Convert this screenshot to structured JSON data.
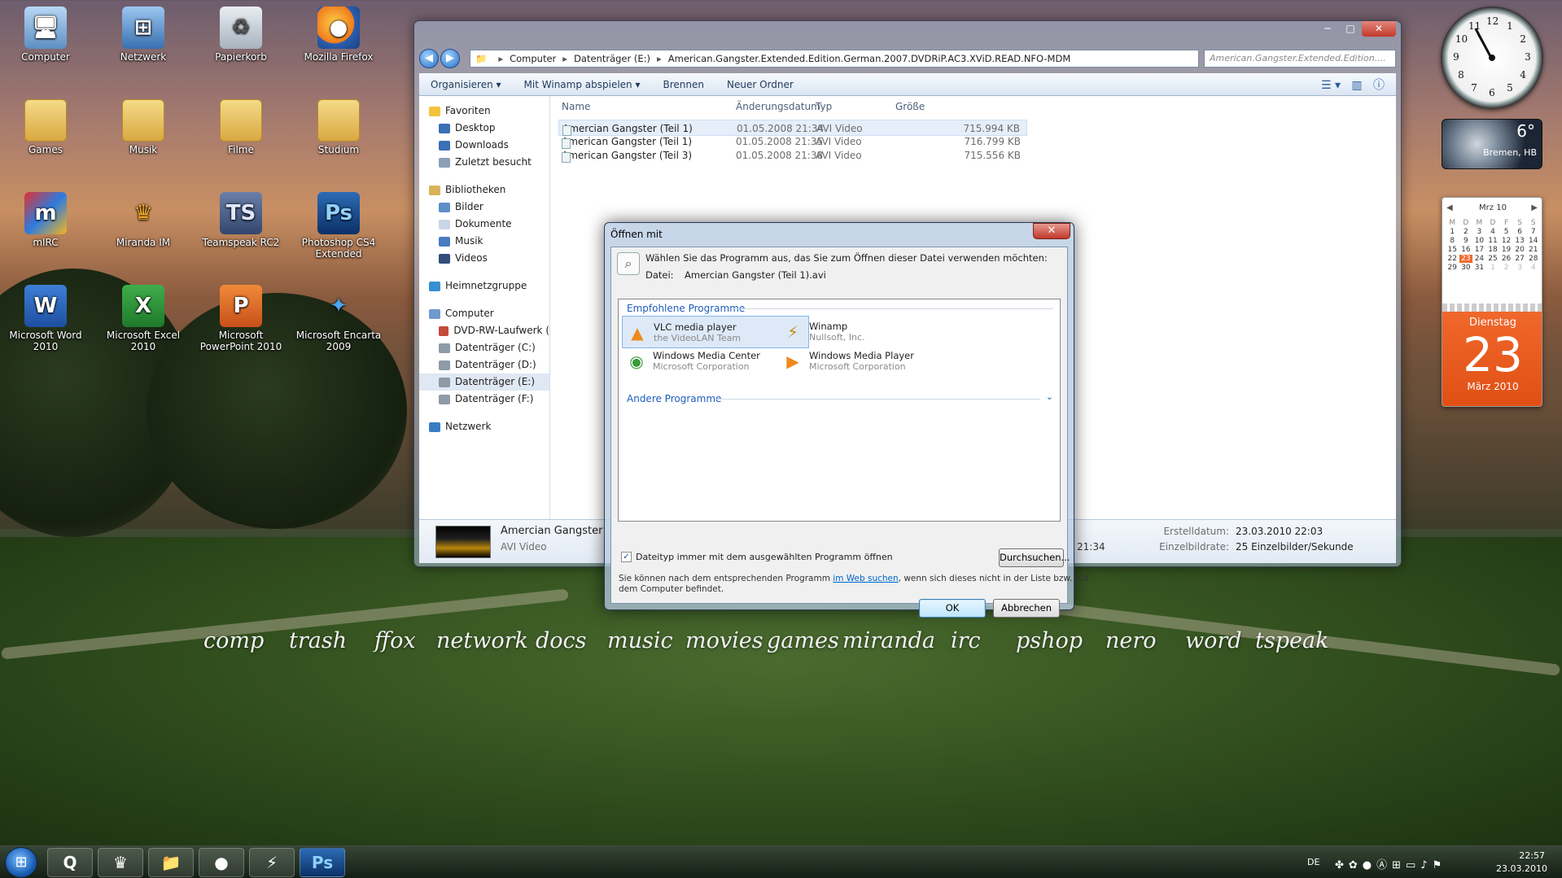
{
  "desktop_icons": [
    {
      "label": "Computer",
      "icon": "computer-icon",
      "glyph": "🖥"
    },
    {
      "label": "Netzwerk",
      "icon": "network-icon",
      "glyph": "⊞"
    },
    {
      "label": "Papierkorb",
      "icon": "recycle-bin-icon",
      "glyph": "♻"
    },
    {
      "label": "Mozilla Firefox",
      "icon": "firefox-icon",
      "glyph": "●"
    },
    {
      "label": "Games",
      "icon": "folder-icon",
      "glyph": ""
    },
    {
      "label": "Musik",
      "icon": "folder-icon",
      "glyph": ""
    },
    {
      "label": "Filme",
      "icon": "folder-icon",
      "glyph": ""
    },
    {
      "label": "Studium",
      "icon": "folder-icon",
      "glyph": ""
    },
    {
      "label": "mIRC",
      "icon": "mirc-icon",
      "glyph": "m"
    },
    {
      "label": "Miranda IM",
      "icon": "miranda-icon",
      "glyph": "♛"
    },
    {
      "label": "Teamspeak RC2",
      "icon": "teamspeak-icon",
      "glyph": "TS"
    },
    {
      "label": "Photoshop CS4 Extended",
      "icon": "photoshop-icon",
      "glyph": "Ps"
    },
    {
      "label": "Microsoft Word 2010",
      "icon": "word-icon",
      "glyph": "W"
    },
    {
      "label": "Microsoft Excel 2010",
      "icon": "excel-icon",
      "glyph": "X"
    },
    {
      "label": "Microsoft PowerPoint 2010",
      "icon": "powerpoint-icon",
      "glyph": "P"
    },
    {
      "label": "Microsoft Encarta 2009",
      "icon": "encarta-icon",
      "glyph": "✦"
    }
  ],
  "dock_labels": [
    "comp",
    "trash",
    "ffox",
    "network",
    "docs",
    "music",
    "movies",
    "games",
    "miranda",
    "irc",
    "pshop",
    "nero",
    "word",
    "tspeak"
  ],
  "explorer": {
    "address": [
      "Computer",
      "Datenträger (E:)",
      "American.Gangster.Extended.Edition.German.2007.DVDRiP.AC3.XViD.READ.NFO-MDM"
    ],
    "search_placeholder": "American.Gangster.Extended.Edition....",
    "commands": {
      "organize": "Organisieren ▾",
      "play": "Mit Winamp abspielen ▾",
      "burn": "Brennen",
      "new_folder": "Neuer Ordner"
    },
    "nav": [
      {
        "label": "Favoriten",
        "indent": 0,
        "color": "#f3c33c"
      },
      {
        "label": "Desktop",
        "indent": 1,
        "color": "#3b6fb6"
      },
      {
        "label": "Downloads",
        "indent": 1,
        "color": "#3b6fb6"
      },
      {
        "label": "Zuletzt besucht",
        "indent": 1,
        "color": "#8aa0b8"
      },
      {
        "label": "",
        "indent": 0,
        "color": ""
      },
      {
        "label": "Bibliotheken",
        "indent": 0,
        "color": "#d8b35a"
      },
      {
        "label": "Bilder",
        "indent": 1,
        "color": "#5e8fc8"
      },
      {
        "label": "Dokumente",
        "indent": 1,
        "color": "#c9d6e6"
      },
      {
        "label": "Musik",
        "indent": 1,
        "color": "#4a7bc0"
      },
      {
        "label": "Videos",
        "indent": 1,
        "color": "#324d78"
      },
      {
        "label": "",
        "indent": 0,
        "color": ""
      },
      {
        "label": "Heimnetzgruppe",
        "indent": 0,
        "color": "#3a8fd1"
      },
      {
        "label": "",
        "indent": 0,
        "color": ""
      },
      {
        "label": "Computer",
        "indent": 0,
        "color": "#6f9ad0"
      },
      {
        "label": "DVD-RW-Laufwerk (",
        "indent": 1,
        "color": "#c44a3a"
      },
      {
        "label": "Datenträger (C:)",
        "indent": 1,
        "color": "#8e9aa8"
      },
      {
        "label": "Datenträger (D:)",
        "indent": 1,
        "color": "#8e9aa8"
      },
      {
        "label": "Datenträger (E:)",
        "indent": 1,
        "color": "#8e9aa8"
      },
      {
        "label": "Datenträger (F:)",
        "indent": 1,
        "color": "#8e9aa8"
      },
      {
        "label": "",
        "indent": 0,
        "color": ""
      },
      {
        "label": "Netzwerk",
        "indent": 0,
        "color": "#3a7cc4"
      }
    ],
    "nav_selected": 17,
    "columns": {
      "name": "Name",
      "date": "Änderungsdatum",
      "type": "Typ",
      "size": "Größe"
    },
    "files": [
      {
        "name": "Amercian Gangster (Teil 1)",
        "date": "01.05.2008 21:34",
        "type": "AVI Video",
        "size": "715.994 KB"
      },
      {
        "name": "American Gangster (Teil 1)",
        "date": "01.05.2008 21:35",
        "type": "AVI Video",
        "size": "716.799 KB"
      },
      {
        "name": "American Gangster (Teil 3)",
        "date": "01.05.2008 21:38",
        "type": "AVI Video",
        "size": "715.556 KB"
      }
    ],
    "details": {
      "name": "Amercian Gangster",
      "type": "AVI Video",
      "length_tail": "21:34",
      "created_label": "Erstelldatum:",
      "created_value": "23.03.2010 22:03",
      "fps_label": "Einzelbildrate:",
      "fps_value": "25 Einzelbilder/Sekunde"
    }
  },
  "dialog": {
    "title": "Öffnen mit",
    "instruction": "Wählen Sie das Programm aus, das Sie zum Öffnen dieser Datei verwenden möchten:",
    "file_label": "Datei:",
    "file_name": "Amercian Gangster (Teil 1).avi",
    "recommended_label": "Empfohlene Programme",
    "other_label": "Andere Programme",
    "programs": [
      {
        "name": "VLC media player",
        "company": "the VideoLAN Team",
        "glyph": "▲",
        "color": "#f08a1c"
      },
      {
        "name": "Winamp",
        "company": "Nullsoft, Inc.",
        "glyph": "⚡",
        "color": "#c98a1a"
      },
      {
        "name": "Windows Media Center",
        "company": "Microsoft Corporation",
        "glyph": "◉",
        "color": "#3a9a3a"
      },
      {
        "name": "Windows Media Player",
        "company": "Microsoft Corporation",
        "glyph": "▶",
        "color": "#f08a1c"
      }
    ],
    "checkbox_label": "Dateityp immer mit dem ausgewählten Programm öffnen",
    "browse_label": "Durchsuchen...",
    "hint_before": "Sie können nach dem entsprechenden Programm ",
    "hint_link": "im Web suchen",
    "hint_after": ", wenn sich dieses nicht in der Liste bzw. auf",
    "hint_line2": "dem Computer befindet.",
    "ok_label": "OK",
    "cancel_label": "Abbrechen"
  },
  "weather": {
    "temp": "6°",
    "location": "Bremen, HB"
  },
  "calendar": {
    "month_short": "Mrz 10",
    "weekdays": [
      "M",
      "D",
      "M",
      "D",
      "F",
      "S",
      "S"
    ],
    "days": [
      "1",
      "2",
      "3",
      "4",
      "5",
      "6",
      "7",
      "8",
      "9",
      "10",
      "11",
      "12",
      "13",
      "14",
      "15",
      "16",
      "17",
      "18",
      "19",
      "20",
      "21",
      "22",
      "23",
      "24",
      "25",
      "26",
      "27",
      "28",
      "29",
      "30",
      "31",
      "1",
      "2",
      "3",
      "4"
    ],
    "selected_day": "23",
    "big_weekday": "Dienstag",
    "big_day": "23",
    "big_month": "März 2010"
  },
  "clock": {
    "numbers": [
      "12",
      "1",
      "2",
      "3",
      "4",
      "5",
      "6",
      "7",
      "8",
      "9",
      "10",
      "11"
    ]
  },
  "taskbar": {
    "lang": "DE",
    "time": "22:57",
    "date": "23.03.2010",
    "apps": [
      "Q",
      "♛",
      "📁",
      "●",
      "⚡",
      "Ps"
    ]
  }
}
